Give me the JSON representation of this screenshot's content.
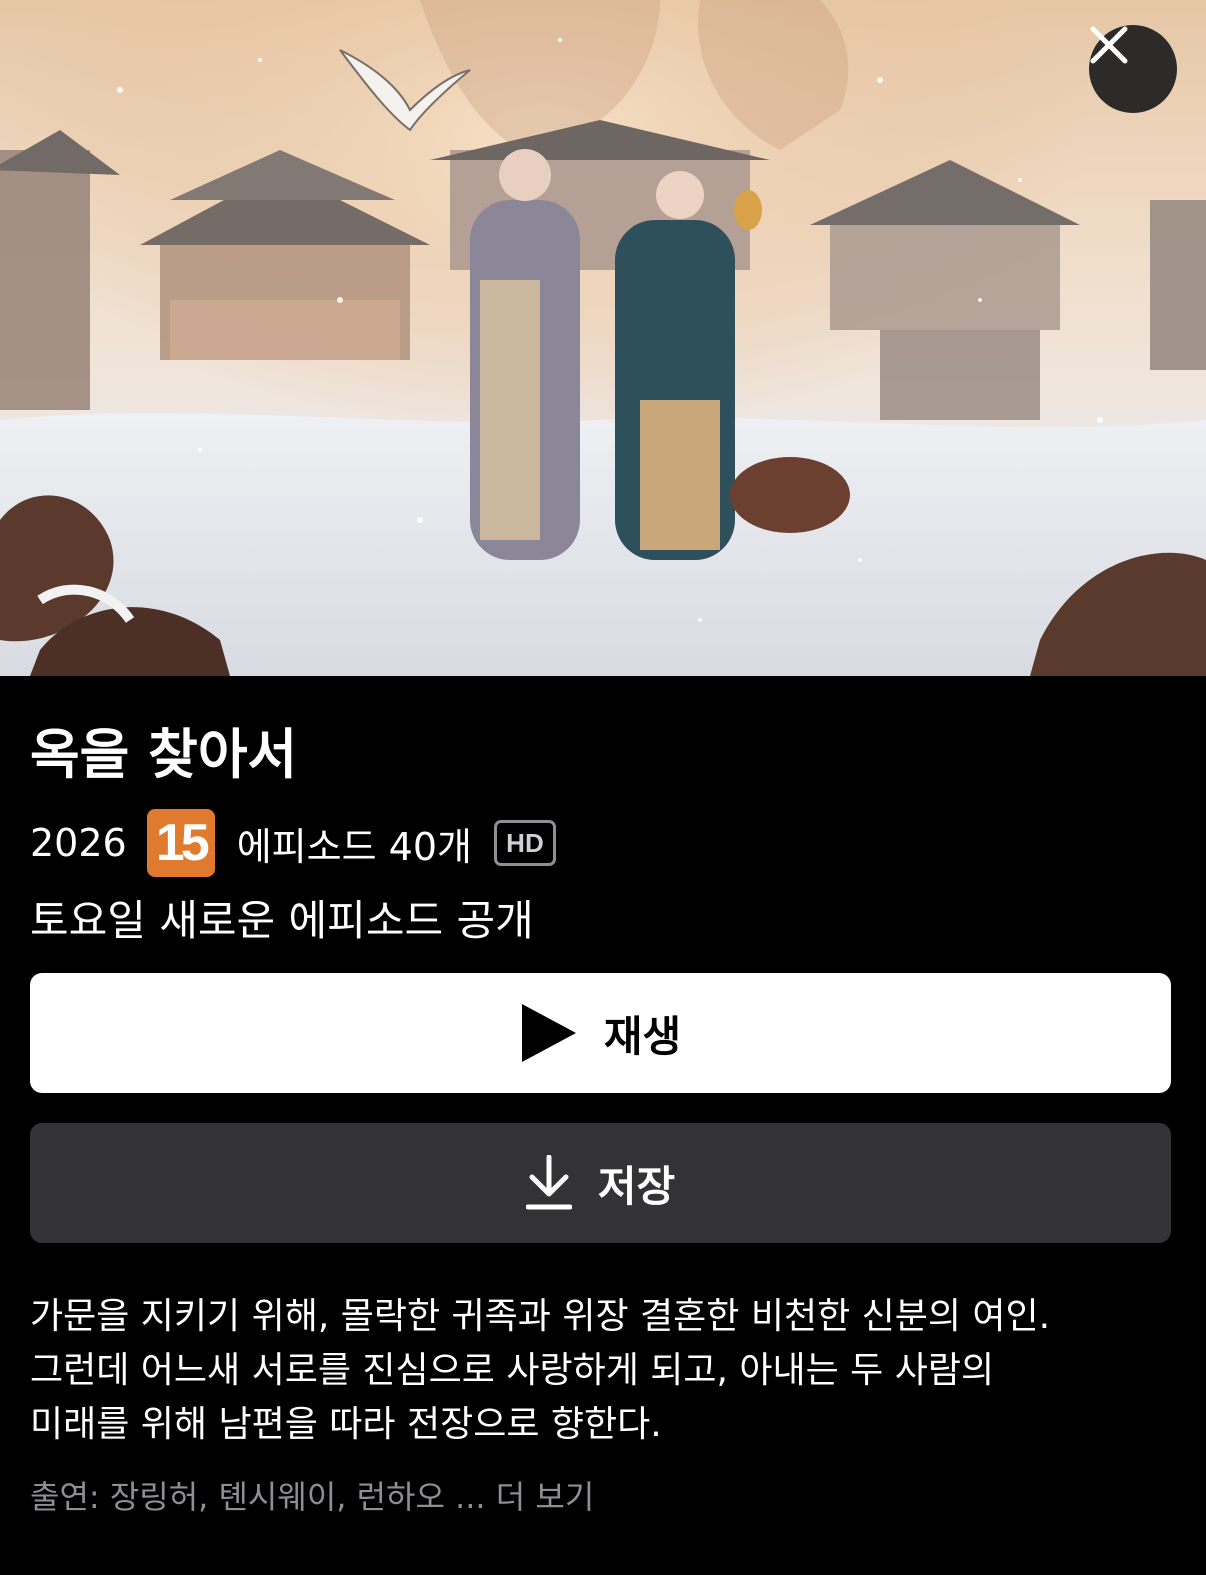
{
  "hero": {
    "image_description": "",
    "close_icon": "close-icon"
  },
  "show": {
    "title": "옥을 찾아서",
    "year": "2026",
    "rating": "15",
    "episodes": "에피소드 40개",
    "quality": "HD",
    "release_note": "토요일 새로운 에피소드 공개"
  },
  "actions": {
    "play_label": "재생",
    "play_icon": "play-icon",
    "save_label": "저장",
    "save_icon": "download-icon"
  },
  "description": {
    "line1": "가문을 지키기 위해, 몰락한 귀족과 위장 결혼한 비천한 신분의 여인.",
    "line2": "그런데 어느새 서로를 진심으로 사랑하게 되고, 아내는 두 사람의",
    "line3": "미래를 위해 남편을 따라 전장으로 향한다."
  },
  "cast": {
    "prefix": "출연: 장링허, 톈시웨이, 런하오 ...",
    "more": "더 보기"
  },
  "colors": {
    "background": "#000000",
    "rating_badge": "#e07a2e",
    "save_button": "#333335",
    "muted_text": "#8e8e93"
  }
}
